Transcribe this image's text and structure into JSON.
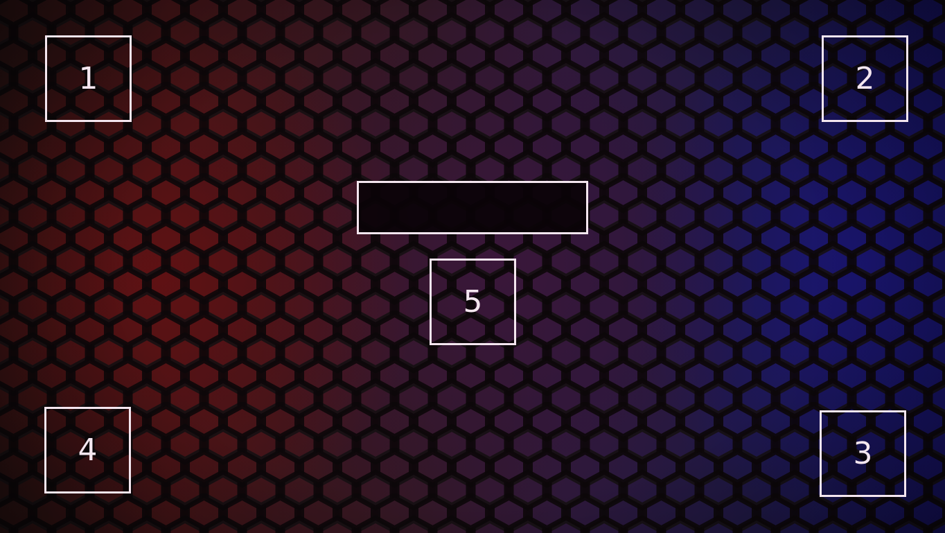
{
  "background": {
    "pattern_icon": "hexagon-grid",
    "colors": {
      "left": "#3c0b0e",
      "center": "#231033",
      "right": "#0c0858",
      "hex_outline": "#0c0709",
      "border": "#f4e6ef"
    }
  },
  "slots": [
    {
      "label": "1"
    },
    {
      "label": "2"
    },
    {
      "label": "3"
    },
    {
      "label": "4"
    },
    {
      "label": "5"
    }
  ],
  "center_bar": {
    "text": ""
  }
}
